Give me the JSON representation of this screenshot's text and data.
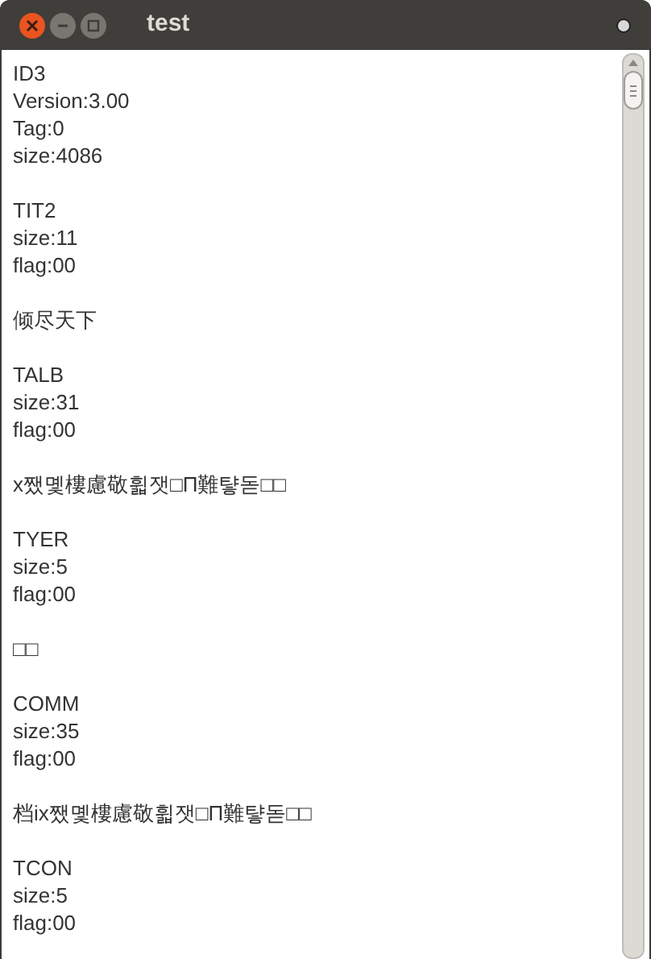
{
  "window": {
    "title": "test"
  },
  "blocks": [
    {
      "lines": [
        "ID3",
        "Version:3.00",
        "Tag:0",
        "size:4086"
      ]
    },
    {
      "lines": [
        "TIT2",
        "size:11",
        "flag:00"
      ]
    },
    {
      "lines": [
        "倾尽天下"
      ]
    },
    {
      "lines": [
        "TALB",
        "size:31",
        "flag:00"
      ]
    },
    {
      "lines": [
        "x쨌몣樓慮敬휣잿□Π難턓돋□□"
      ]
    },
    {
      "lines": [
        "TYER",
        "size:5",
        "flag:00"
      ]
    },
    {
      "lines": [
        "□□"
      ]
    },
    {
      "lines": [
        "COMM",
        "size:35",
        "flag:00"
      ]
    },
    {
      "lines": [
        "档ix쨌몣樓慮敬휣잿□Π難턓돋□□"
      ]
    },
    {
      "lines": [
        "TCON",
        "size:5",
        "flag:00"
      ]
    }
  ]
}
